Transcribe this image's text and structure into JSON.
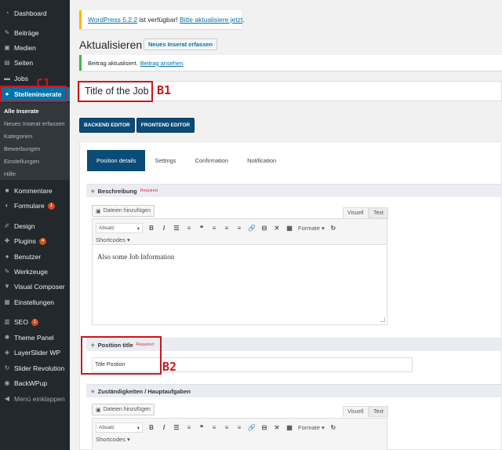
{
  "sidebar": {
    "items": [
      {
        "label": "Dashboard",
        "icon": "dashboard-icon",
        "glyph": "◔"
      },
      {
        "label": "Beiträge",
        "icon": "pin-icon",
        "glyph": "✎"
      },
      {
        "label": "Medien",
        "icon": "media-icon",
        "glyph": "▣"
      },
      {
        "label": "Seiten",
        "icon": "pages-icon",
        "glyph": "▤"
      },
      {
        "label": "Jobs",
        "icon": "folder-icon",
        "glyph": "▬"
      },
      {
        "label": "Stelleninserate",
        "icon": "person-icon",
        "glyph": "●"
      },
      {
        "label": "Kommentare",
        "icon": "comments-icon",
        "glyph": "■"
      },
      {
        "label": "Formulare",
        "icon": "forms-icon",
        "glyph": "◐",
        "badge": "1"
      },
      {
        "label": "Design",
        "icon": "brush-icon",
        "glyph": "✐"
      },
      {
        "label": "Plugins",
        "icon": "plugin-icon",
        "glyph": "✚",
        "badge": "4"
      },
      {
        "label": "Benutzer",
        "icon": "users-icon",
        "glyph": "●"
      },
      {
        "label": "Werkzeuge",
        "icon": "wrench-icon",
        "glyph": "✎"
      },
      {
        "label": "Visual Composer",
        "icon": "vc-icon",
        "glyph": "▼"
      },
      {
        "label": "Einstellungen",
        "icon": "settings-icon",
        "glyph": "▦"
      },
      {
        "label": "SEO",
        "icon": "seo-icon",
        "glyph": "▥",
        "badge": "1"
      },
      {
        "label": "Theme Panel",
        "icon": "gear-icon",
        "glyph": "✺"
      },
      {
        "label": "LayerSlider WP",
        "icon": "layers-icon",
        "glyph": "◈"
      },
      {
        "label": "Slider Revolution",
        "icon": "refresh-icon",
        "glyph": "↻"
      },
      {
        "label": "BackWPup",
        "icon": "backup-icon",
        "glyph": "◉"
      },
      {
        "label": "Menü einklappen",
        "icon": "collapse-icon",
        "glyph": "◀"
      }
    ],
    "submenu": [
      "Alle Inserate",
      "Neues Inserat erfassen",
      "Kategorien",
      "Bewerbungen",
      "Einstellungen",
      "Hilfe"
    ]
  },
  "notices": {
    "update_link": "WordPress 5.2.2",
    "update_mid": " ist verfügbar! ",
    "update_action": "Bitte aktualisiere jetzt",
    "update_end": ".",
    "success_text": "Beitrag aktualisiert.",
    "success_link": "Beitrag ansehen"
  },
  "header": {
    "title": "Aktualisieren",
    "add_new": "Neues Inserat erfassen"
  },
  "post_title": "Title of the Job",
  "editor_buttons": {
    "backend": "BACKEND EDITOR",
    "frontend": "FRONTEND EDITOR"
  },
  "tabs": [
    "Position details",
    "Settings",
    "Confirmation",
    "Notification"
  ],
  "fields": {
    "beschreibung": {
      "label": "Beschreibung",
      "required": "Required",
      "content": "Also some Job Information"
    },
    "position_title": {
      "label": "Position title",
      "required": "Required",
      "value": "Title Postion"
    },
    "zustaendigkeiten": {
      "label": "Zuständigkeiten / Hauptaufgaben"
    }
  },
  "editor": {
    "add_media": "Dateien hinzufügen",
    "visual": "Visuell",
    "text": "Text",
    "format_select": "Absatz",
    "format_menu": "Formate",
    "shortcodes": "Shortcodes"
  },
  "annotations": {
    "c1": "C1",
    "b1": "B1",
    "b2": "B2"
  },
  "colors": {
    "sidebar": "#23282d",
    "active": "#0073aa",
    "tab_active": "#0a4b78",
    "annotation": "#c8181e",
    "warning": "#ffb900",
    "success": "#46b450"
  }
}
